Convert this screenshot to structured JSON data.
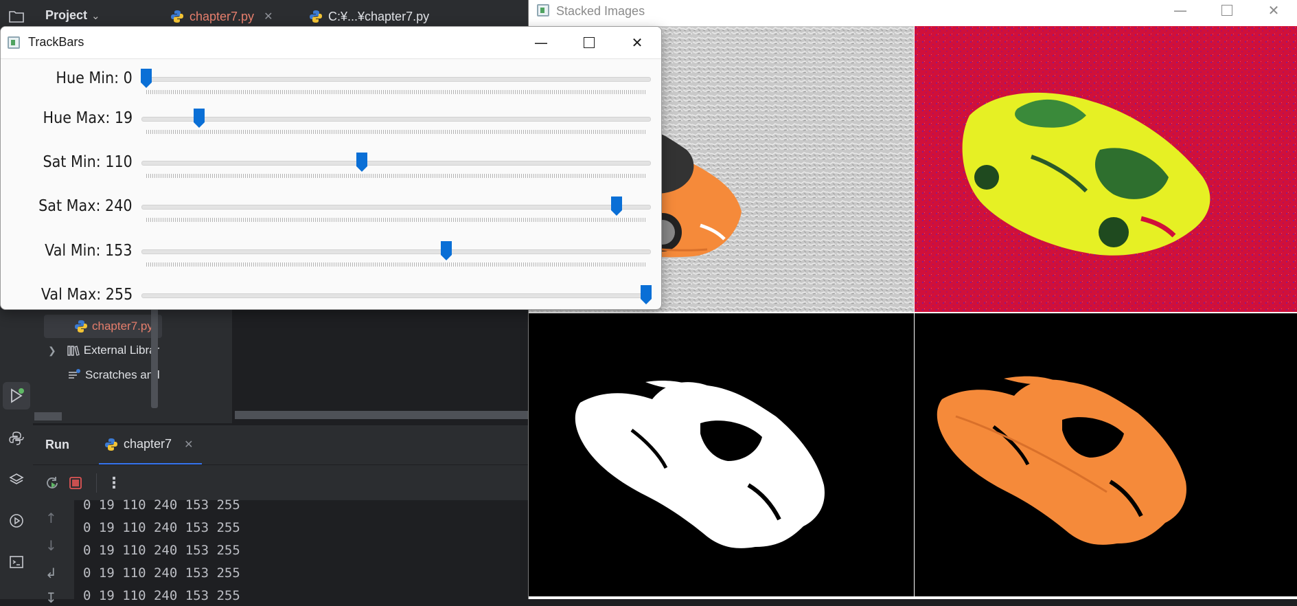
{
  "ide": {
    "project_label": "Project",
    "tabs": [
      {
        "label": "chapter7.py"
      },
      {
        "label": "C:¥...¥chapter7.py"
      }
    ],
    "tree": {
      "selected_file": "chapter7.py",
      "external_libraries": "External Librar",
      "scratches": "Scratches and"
    },
    "run_panel": {
      "title": "Run",
      "tab_label": "chapter7"
    },
    "console_lines": [
      "0 19 110 240 153 255",
      "0 19 110 240 153 255",
      "0 19 110 240 153 255",
      "0 19 110 240 153 255",
      "0 19 110 240 153 255"
    ]
  },
  "stacked_window": {
    "title": "Stacked Images"
  },
  "trackbars_window": {
    "title": "TrackBars",
    "sliders": [
      {
        "label": "Hue Min: 0",
        "value": 0,
        "max": 179
      },
      {
        "label": "Hue Max: 19",
        "value": 19,
        "max": 179
      },
      {
        "label": "Sat Min: 110",
        "value": 110,
        "max": 255
      },
      {
        "label": "Sat Max: 240",
        "value": 240,
        "max": 255
      },
      {
        "label": "Val Min: 153",
        "value": 153,
        "max": 255
      },
      {
        "label": "Val Max: 255",
        "value": 255,
        "max": 255
      }
    ]
  },
  "colors": {
    "accent": "#0a6fd6",
    "ide_bg": "#1e1f22",
    "ide_panel": "#2b2d30",
    "file_modified": "#e77f6d",
    "car_orange": "#f58a3a",
    "hsv_red": "#d0103a",
    "hsv_yellow": "#e6f024"
  }
}
